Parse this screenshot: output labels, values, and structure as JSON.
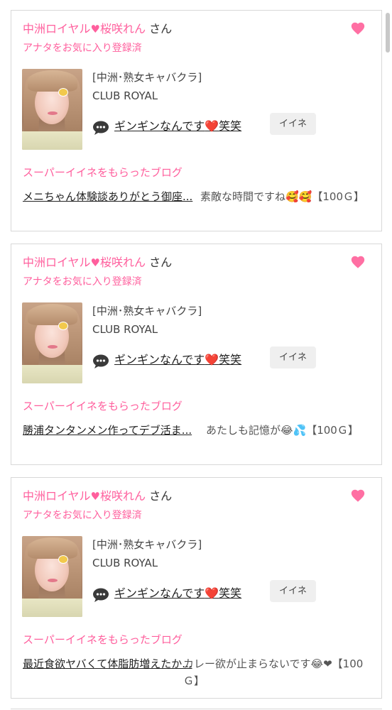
{
  "cards": [
    {
      "title": {
        "name": "中洲ロイヤル",
        "heart": "♥",
        "name2": "桜咲れん",
        "suffix": "さん"
      },
      "favorite_status": "アナタをお気に入り登録済",
      "shop": {
        "category": "[中洲･熟女キャバクラ]",
        "name": "CLUB ROYAL"
      },
      "post": {
        "text_before": "ギンギンなんです",
        "heart": "❤️",
        "text_after": "笑笑"
      },
      "iine_label": "イイネ",
      "super_label": "スーパーイイネをもらったブログ",
      "blog": {
        "title": "メニちゃん体験談ありがとう御座...",
        "comment": "素敵な時間ですね🥰🥰【100Ｇ】"
      }
    },
    {
      "title": {
        "name": "中洲ロイヤル",
        "heart": "♥",
        "name2": "桜咲れん",
        "suffix": "さん"
      },
      "favorite_status": "アナタをお気に入り登録済",
      "shop": {
        "category": "[中洲･熟女キャバクラ]",
        "name": "CLUB ROYAL"
      },
      "post": {
        "text_before": "ギンギンなんです",
        "heart": "❤️",
        "text_after": "笑笑"
      },
      "iine_label": "イイネ",
      "super_label": "スーパーイイネをもらったブログ",
      "blog": {
        "title": "勝浦タンタンメン作ってデブ活ま...",
        "comment": "あたしも記憶が😂💦【100Ｇ】"
      }
    },
    {
      "title": {
        "name": "中洲ロイヤル",
        "heart": "♥",
        "name2": "桜咲れん",
        "suffix": "さん"
      },
      "favorite_status": "アナタをお気に入り登録済",
      "shop": {
        "category": "[中洲･熟女キャバクラ]",
        "name": "CLUB ROYAL"
      },
      "post": {
        "text_before": "ギンギンなんです",
        "heart": "❤️",
        "text_after": "笑笑"
      },
      "iine_label": "イイネ",
      "super_label": "スーパーイイネをもらったブログ",
      "blog": {
        "title": "最近食欲ヤバくて体脂肪増えたか...",
        "comment": "カレー欲が止まらないです😂❤【100Ｇ】"
      }
    }
  ],
  "colors": {
    "accent_pink": "#ff5f9d",
    "heart_red": "#e02424",
    "card_border": "#d8d8d8",
    "button_bg": "#efefef"
  },
  "icons": {
    "favorite": "heart-icon",
    "comment": "speech-bubble-icon"
  }
}
